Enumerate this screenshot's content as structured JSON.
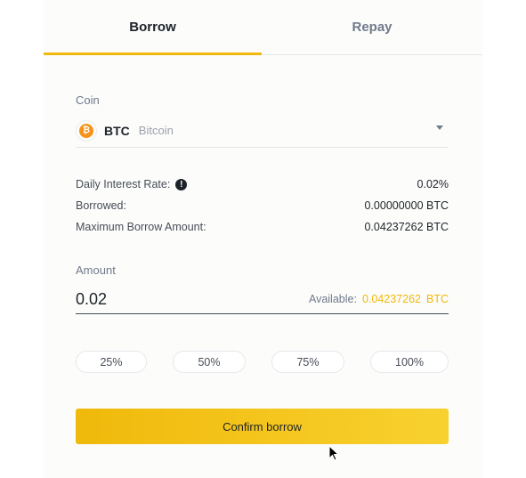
{
  "tabs": [
    {
      "label": "Borrow",
      "active": true
    },
    {
      "label": "Repay",
      "active": false
    }
  ],
  "coin": {
    "label": "Coin",
    "symbol": "BTC",
    "name": "Bitcoin",
    "icon_glyph": "₿",
    "icon": "bitcoin-icon",
    "icon_color": "#f7931a"
  },
  "info": {
    "interest_label": "Daily Interest Rate:",
    "interest_value": "0.02%",
    "borrowed_label": "Borrowed:",
    "borrowed_value": "0.00000000 BTC",
    "max_label": "Maximum Borrow Amount:",
    "max_value": "0.04237262 BTC"
  },
  "amount": {
    "label": "Amount",
    "value": "0.02",
    "available_label": "Available:",
    "available_value": "0.04237262",
    "available_unit": "BTC"
  },
  "percent_buttons": [
    "25%",
    "50%",
    "75%",
    "100%"
  ],
  "confirm_label": "Confirm borrow",
  "colors": {
    "accent": "#f0b90b",
    "text": "#1e2329",
    "muted": "#707a8a"
  }
}
